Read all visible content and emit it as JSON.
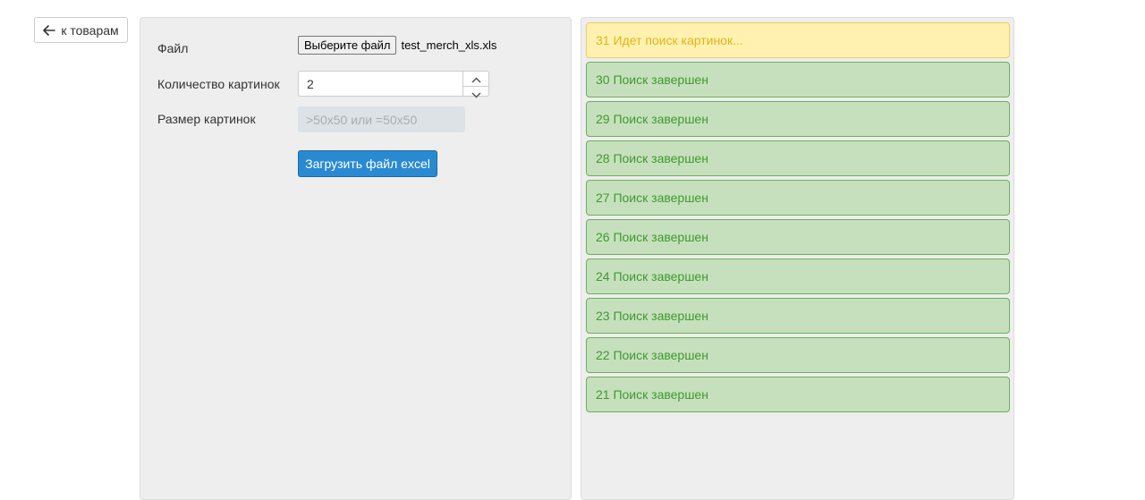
{
  "nav": {
    "back_label": "к товарам"
  },
  "form": {
    "file_label": "Файл",
    "file_button_label": "Выберите файл",
    "file_name": "test_merch_xls.xls",
    "count_label": "Количество картинок",
    "count_value": "2",
    "size_label": "Размер картинок",
    "size_placeholder": ">50x50 или =50x50",
    "upload_label": "Загрузить файл excel"
  },
  "jobs": [
    {
      "text": "31 Идет поиск картинок...",
      "status": "pending"
    },
    {
      "text": "30 Поиск завершен",
      "status": "done"
    },
    {
      "text": "29 Поиск завершен",
      "status": "done"
    },
    {
      "text": "28 Поиск завершен",
      "status": "done"
    },
    {
      "text": "27 Поиск завершен",
      "status": "done"
    },
    {
      "text": "26 Поиск завершен",
      "status": "done"
    },
    {
      "text": "24 Поиск завершен",
      "status": "done"
    },
    {
      "text": "23 Поиск завершен",
      "status": "done"
    },
    {
      "text": "22 Поиск завершен",
      "status": "done"
    },
    {
      "text": "21 Поиск завершен",
      "status": "done"
    }
  ],
  "colors": {
    "primary_button": "#2a8ad1",
    "pending_bg": "#fff2b0",
    "pending_text": "#e3b21a",
    "done_bg": "#c6e0bd",
    "done_text": "#3f9a2f"
  },
  "icons": {
    "back": "arrow-left-icon",
    "step_up": "chevron-up-icon",
    "step_down": "chevron-down-icon"
  }
}
